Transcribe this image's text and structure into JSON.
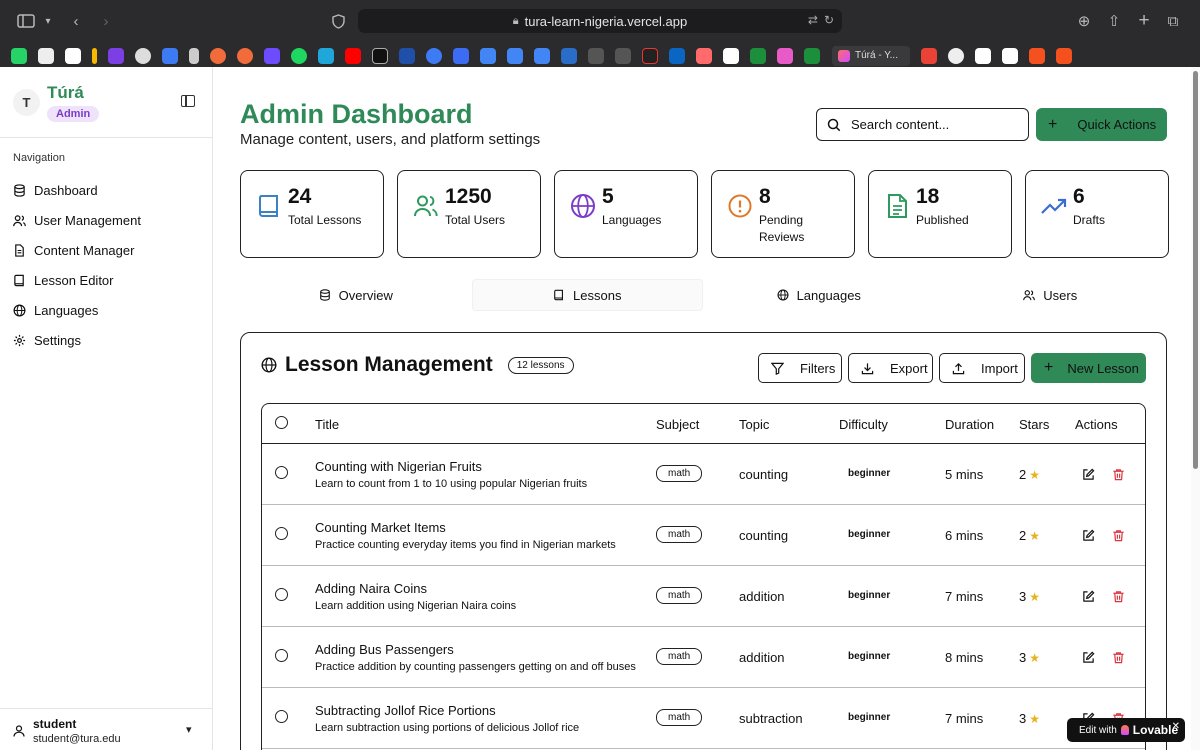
{
  "browser": {
    "url": "tura-learn-nigeria.vercel.app",
    "tab_title": "Túrá - Y..."
  },
  "sidebar": {
    "avatar_initial": "T",
    "brand_name": "Túrá",
    "brand_badge": "Admin",
    "nav_heading": "Navigation",
    "items": [
      {
        "label": "Dashboard",
        "icon": "database-icon"
      },
      {
        "label": "User Management",
        "icon": "users-icon"
      },
      {
        "label": "Content Manager",
        "icon": "file-text-icon"
      },
      {
        "label": "Lesson Editor",
        "icon": "book-icon"
      },
      {
        "label": "Languages",
        "icon": "globe-icon"
      },
      {
        "label": "Settings",
        "icon": "gear-icon"
      }
    ],
    "user": {
      "name": "student",
      "email": "student@tura.edu"
    }
  },
  "header": {
    "title": "Admin Dashboard",
    "subtitle": "Manage content, users, and platform settings",
    "search_placeholder": "Search content...",
    "quick_actions_label": "Quick Actions"
  },
  "stats": [
    {
      "value": "24",
      "label": "Total Lessons",
      "icon": "book-icon",
      "color": "#3b82c4"
    },
    {
      "value": "1250",
      "label": "Total Users",
      "icon": "users-icon",
      "color": "#2f9a5e"
    },
    {
      "value": "5",
      "label": "Languages",
      "icon": "globe-icon",
      "color": "#7c3cc6"
    },
    {
      "value": "8",
      "label": "Pending Reviews",
      "icon": "alert-circle-icon",
      "color": "#e0782a"
    },
    {
      "value": "18",
      "label": "Published",
      "icon": "file-text-icon",
      "color": "#2f9a5e"
    },
    {
      "value": "6",
      "label": "Drafts",
      "icon": "trending-up-icon",
      "color": "#3b6cd4"
    }
  ],
  "tabs": [
    {
      "label": "Overview",
      "icon": "database-icon",
      "active": false
    },
    {
      "label": "Lessons",
      "icon": "book-icon",
      "active": true
    },
    {
      "label": "Languages",
      "icon": "globe-icon",
      "active": false
    },
    {
      "label": "Users",
      "icon": "users-icon",
      "active": false
    }
  ],
  "lesson_panel": {
    "title": "Lesson Management",
    "count_badge": "12 lessons",
    "filters_label": "Filters",
    "export_label": "Export",
    "import_label": "Import",
    "new_lesson_label": "New Lesson",
    "columns": [
      "Title",
      "Subject",
      "Topic",
      "Difficulty",
      "Duration",
      "Stars",
      "Actions"
    ],
    "rows": [
      {
        "title": "Counting with Nigerian Fruits",
        "desc": "Learn to count from 1 to 10 using popular Nigerian fruits",
        "subject": "math",
        "topic": "counting",
        "difficulty": "beginner",
        "duration": "5 mins",
        "stars": "2"
      },
      {
        "title": "Counting Market Items",
        "desc": "Practice counting everyday items you find in Nigerian markets",
        "subject": "math",
        "topic": "counting",
        "difficulty": "beginner",
        "duration": "6 mins",
        "stars": "2"
      },
      {
        "title": "Adding Naira Coins",
        "desc": "Learn addition using Nigerian Naira coins",
        "subject": "math",
        "topic": "addition",
        "difficulty": "beginner",
        "duration": "7 mins",
        "stars": "3"
      },
      {
        "title": "Adding Bus Passengers",
        "desc": "Practice addition by counting passengers getting on and off buses",
        "subject": "math",
        "topic": "addition",
        "difficulty": "beginner",
        "duration": "8 mins",
        "stars": "3"
      },
      {
        "title": "Subtracting Jollof Rice Portions",
        "desc": "Learn subtraction using portions of delicious Jollof rice",
        "subject": "math",
        "topic": "subtraction",
        "difficulty": "beginner",
        "duration": "7 mins",
        "stars": "3"
      }
    ]
  },
  "badge": {
    "prefix": "Edit with",
    "brand": "Lovable"
  },
  "colors": {
    "brand_green": "#2f8a58",
    "star": "#e4b41c",
    "delete_red": "#d9363e"
  }
}
